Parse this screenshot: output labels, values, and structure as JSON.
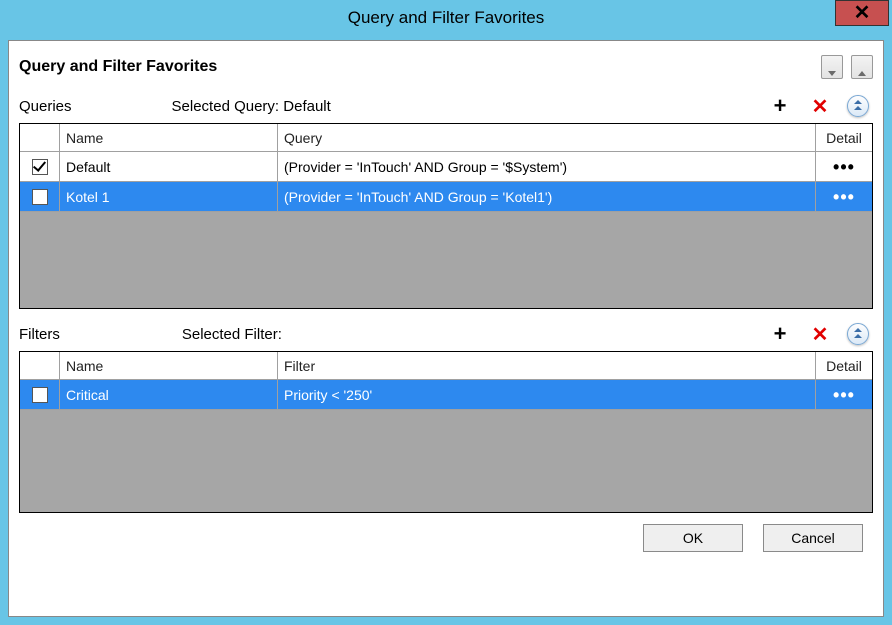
{
  "window": {
    "title": "Query and Filter Favorites"
  },
  "panel": {
    "heading": "Query and Filter Favorites"
  },
  "queries": {
    "section_label": "Queries",
    "selected_label_prefix": "Selected Query:",
    "selected_value": "Default",
    "headers": {
      "name": "Name",
      "query": "Query",
      "detail": "Detail"
    },
    "rows": [
      {
        "checked": true,
        "selected": false,
        "name": "Default",
        "query": "(Provider = 'InTouch' AND Group = '$System')"
      },
      {
        "checked": false,
        "selected": true,
        "name": "Kotel 1",
        "query": "(Provider = 'InTouch' AND Group = 'Kotel1')"
      }
    ]
  },
  "filters": {
    "section_label": "Filters",
    "selected_label_prefix": "Selected Filter:",
    "selected_value": "",
    "headers": {
      "name": "Name",
      "filter": "Filter",
      "detail": "Detail"
    },
    "rows": [
      {
        "checked": false,
        "selected": true,
        "name": "Critical",
        "filter": "Priority < '250'"
      }
    ]
  },
  "buttons": {
    "ok": "OK",
    "cancel": "Cancel"
  },
  "icons": {
    "plus": "+",
    "delete": "✕",
    "dots": "•••"
  }
}
